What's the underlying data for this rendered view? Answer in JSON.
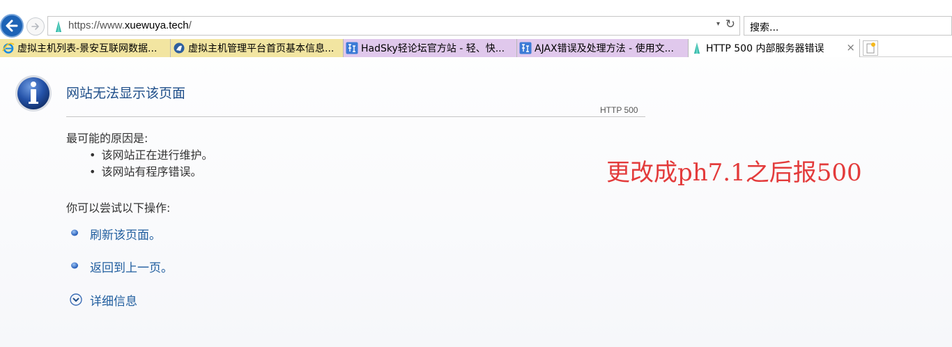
{
  "browser": {
    "url_prefix": "https://www.",
    "url_domain": "xuewuya.tech",
    "url_suffix": "/",
    "dropdown_glyph": "▾",
    "refresh_glyph": "↻",
    "search_text": "搜索...",
    "tabs": [
      {
        "label": "虚拟主机列表-景安互联网数据...",
        "icon": "ie-icon"
      },
      {
        "label": "虚拟主机管理平台首页基本信息...",
        "icon": "host-panel-icon"
      },
      {
        "label": "HadSky轻论坛官方站 - 轻、快...",
        "icon": "hadsky-icon"
      },
      {
        "label": "AJAX错误及处理方法 - 使用文...",
        "icon": "hadsky-icon"
      },
      {
        "label": "HTTP 500 内部服务器错误",
        "icon": "site-favicon-icon",
        "close": "×"
      }
    ]
  },
  "error_page": {
    "title": "网站无法显示该页面",
    "http_code": "HTTP 500",
    "causes_heading": "最可能的原因是:",
    "causes": [
      "该网站正在进行维护。",
      "该网站有程序错误。"
    ],
    "bullet": "•",
    "actions_heading": "你可以尝试以下操作:",
    "actions": {
      "refresh": "刷新该页面。",
      "back": "返回到上一页。",
      "details": "详细信息"
    }
  },
  "annotation": "更改成ph7.1之后报500",
  "colors": {
    "title": "#1f4f8a",
    "link": "#1f5d9e",
    "annotation": "#e33b3b",
    "tab_yellow": "#f2e5a1",
    "tab_purple": "#e0c8ec"
  }
}
